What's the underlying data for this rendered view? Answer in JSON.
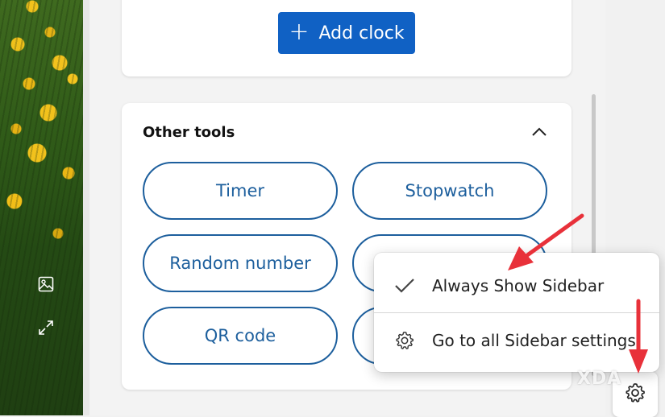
{
  "top_card": {
    "add_clock_label": "Add clock"
  },
  "tools_card": {
    "title": "Other tools",
    "buttons": [
      "Timer",
      "Stopwatch",
      "Random number",
      "",
      "QR code",
      ""
    ]
  },
  "context_menu": {
    "items": [
      {
        "label": "Always Show Sidebar",
        "icon": "checkmark-icon",
        "checked": true
      },
      {
        "label": "Go to all Sidebar settings",
        "icon": "gear-icon"
      }
    ]
  },
  "watermark": "XDA",
  "colors": {
    "accent": "#1061c4",
    "pill_border": "#1d5f9d",
    "annotation_arrow": "#e8313a"
  }
}
